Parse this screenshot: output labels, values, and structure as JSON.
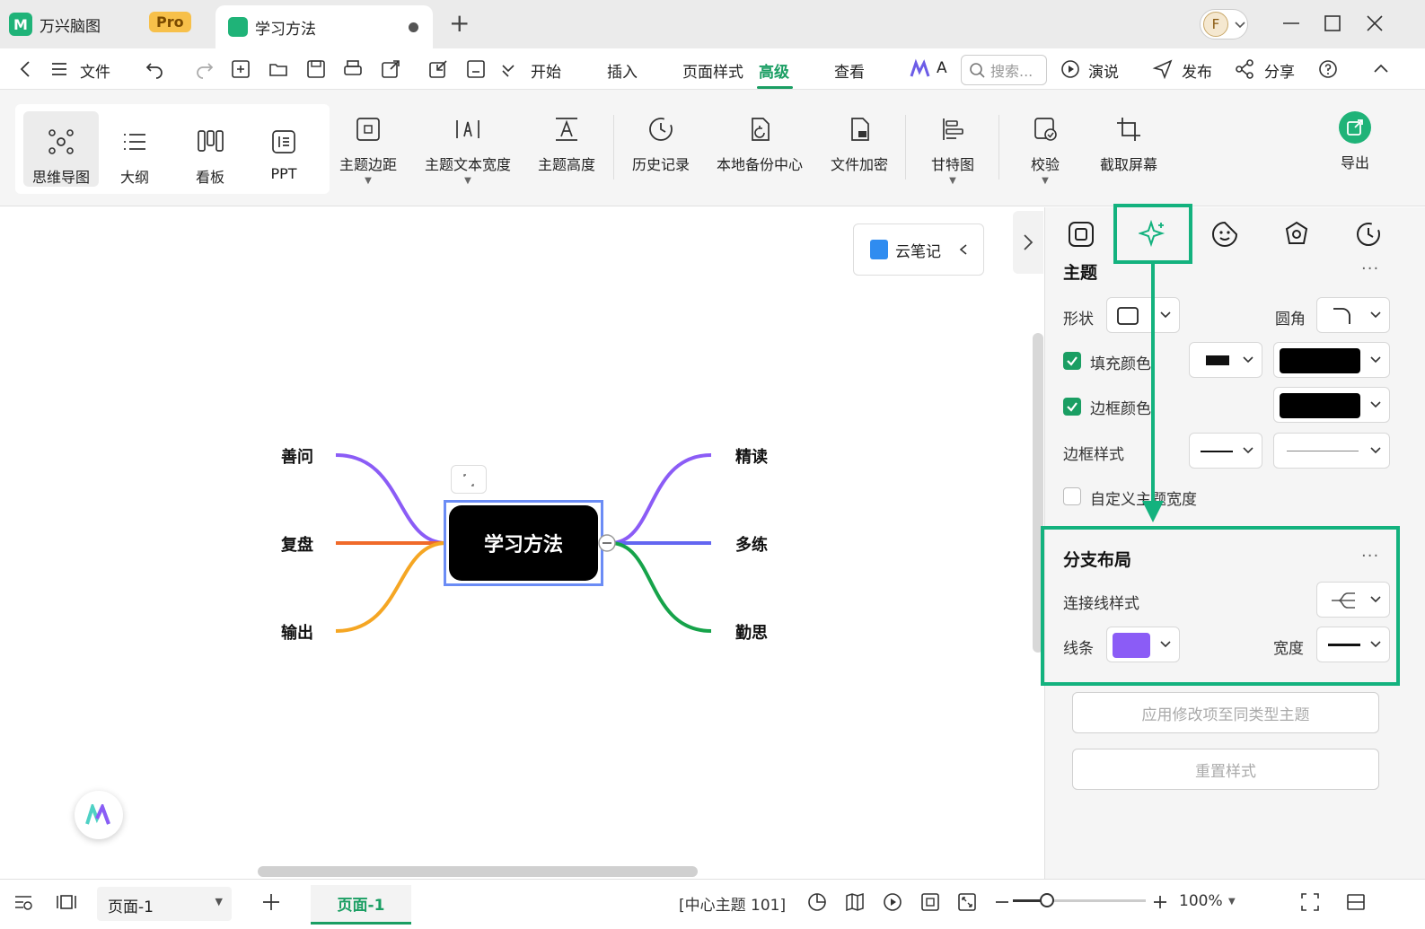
{
  "titlebar": {
    "app_name": "万兴脑图",
    "pro_badge": "Pro",
    "doc_tab": "学习方法",
    "new_tab": "+",
    "avatar_letter": "F"
  },
  "menubar": {
    "file": "文件",
    "tabs": [
      "开始",
      "插入",
      "页面样式",
      "高级",
      "查看"
    ],
    "active_tab": "高级",
    "ai_label": "A",
    "search_placeholder": "搜索...",
    "present": "演说",
    "publish": "发布",
    "share": "分享"
  },
  "toolbar": {
    "views": [
      "思维导图",
      "大纲",
      "看板",
      "PPT"
    ],
    "tools": [
      "主题边距",
      "主题文本宽度",
      "主题高度",
      "历史记录",
      "本地备份中心",
      "文件加密",
      "甘特图",
      "校验",
      "截取屏幕"
    ],
    "export": "导出"
  },
  "canvas": {
    "cloud_note": "云笔记",
    "central_topic": "学习方法",
    "left_branches": [
      "善问",
      "复盘",
      "输出"
    ],
    "right_branches": [
      "精读",
      "多练",
      "勤思"
    ],
    "branch_colors": {
      "善问": "#8b5cf6",
      "复盘": "#f06a2a",
      "输出": "#f5a623",
      "精读": "#8b5cf6",
      "多练": "#6366f1",
      "勤思": "#16a34a"
    }
  },
  "panel": {
    "topic_section": "主题",
    "shape_label": "形状",
    "corner_label": "圆角",
    "fill_label": "填充颜色",
    "border_color_label": "边框颜色",
    "border_style_label": "边框样式",
    "custom_width_label": "自定义主题宽度",
    "branch_section": "分支布局",
    "connector_label": "连接线样式",
    "line_label": "线条",
    "width_label": "宽度",
    "line_color": "#8b5cf6",
    "apply_button": "应用修改项至同类型主题",
    "reset_button": "重置样式"
  },
  "statusbar": {
    "page_select": "页面-1",
    "page_tab": "页面-1",
    "center_topic_info": "[中心主题 101]",
    "zoom": "100%"
  },
  "accent": "#13b27e"
}
